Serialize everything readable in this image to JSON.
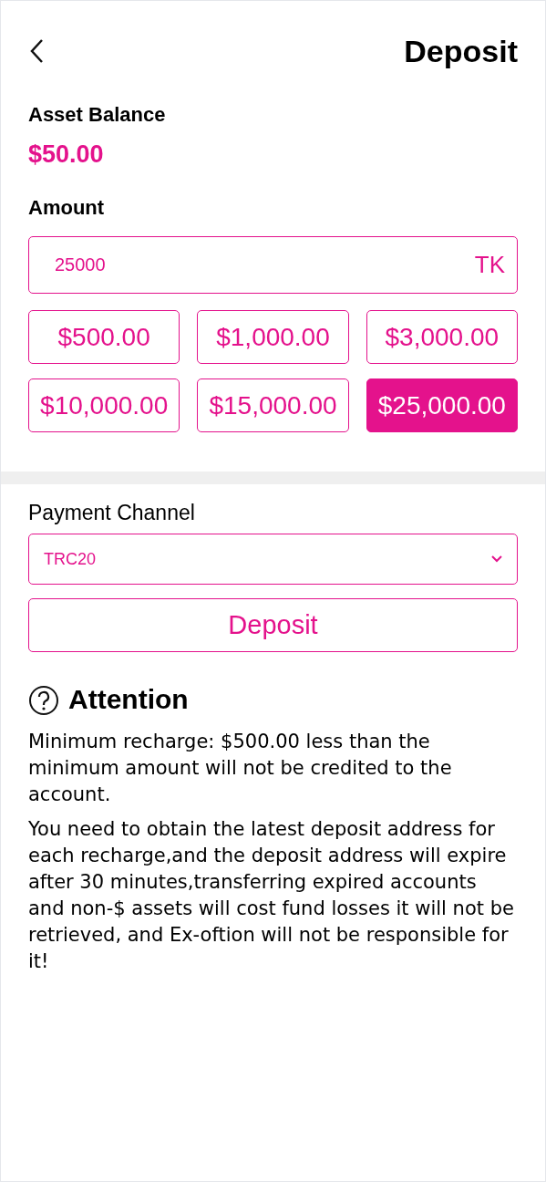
{
  "header": {
    "title": "Deposit"
  },
  "balance": {
    "label": "Asset Balance",
    "value": "$50.00"
  },
  "amount": {
    "label": "Amount",
    "value": "25000",
    "unit": "TK",
    "options": [
      {
        "label": "$500.00",
        "selected": false
      },
      {
        "label": "$1,000.00",
        "selected": false
      },
      {
        "label": "$3,000.00",
        "selected": false
      },
      {
        "label": "$10,000.00",
        "selected": false
      },
      {
        "label": "$15,000.00",
        "selected": false
      },
      {
        "label": "$25,000.00",
        "selected": true
      }
    ]
  },
  "payment": {
    "label": "Payment Channel",
    "value": "TRC20"
  },
  "deposit_button": "Deposit",
  "attention": {
    "title": "Attention",
    "paragraphs": [
      "Minimum recharge: $500.00 less than the minimum amount will not be credited to the account.",
      "You need to obtain the latest deposit address for each recharge,and the deposit address will expire after 30 minutes,transferring expired accounts and non-$ assets will cost fund losses it will not be retrieved, and Ex-oftion will not be responsible for it!"
    ]
  }
}
